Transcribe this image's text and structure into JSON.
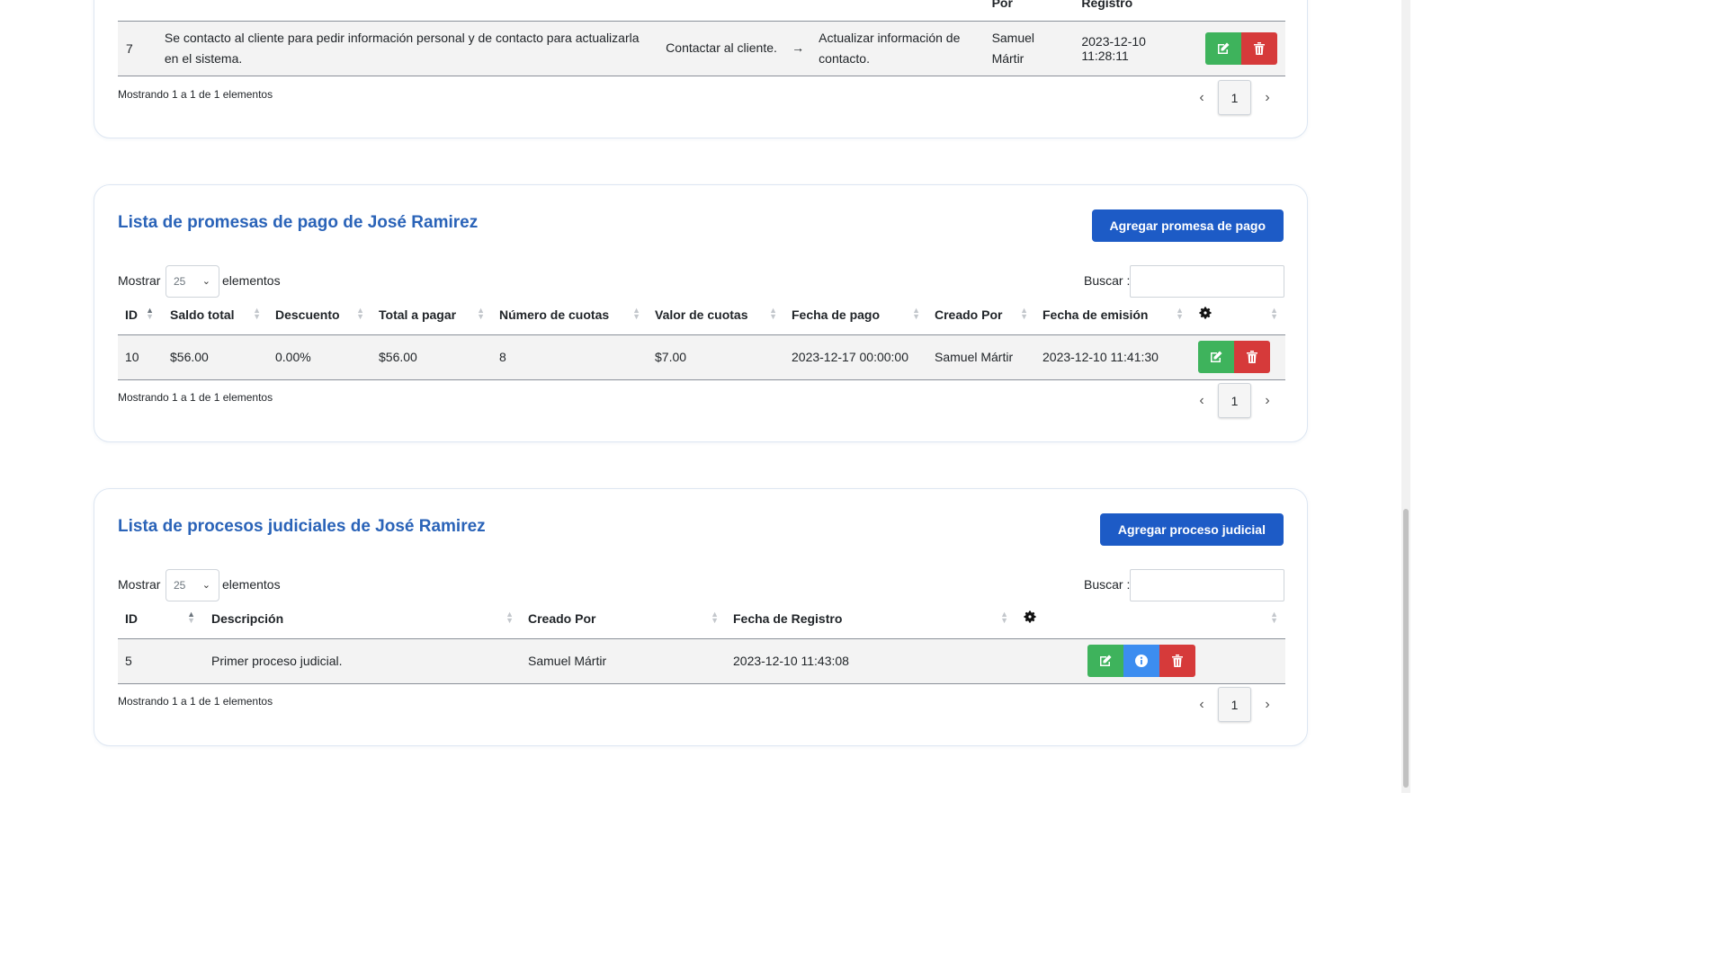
{
  "tracking_table": {
    "headers": {
      "por": "Por",
      "registro": "Registro"
    },
    "row": {
      "id": "7",
      "description": "Se contacto al cliente para pedir información personal y de contacto para actualizarla en el sistema.",
      "action": "Contactar al cliente.",
      "arrow": "→",
      "result": "Actualizar información de contacto.",
      "created_by": "Samuel Mártir",
      "date": "2023-12-10 11:28:11"
    },
    "info": "Mostrando 1 a 1 de 1 elementos",
    "page": "1"
  },
  "payment_promises": {
    "title": "Lista de promesas de pago de José Ramirez",
    "add_button": "Agregar promesa de pago",
    "show_label": "Mostrar",
    "page_size": "25",
    "elements_label": "elementos",
    "search_label": "Buscar :",
    "search_value": "",
    "columns": [
      "ID",
      "Saldo total",
      "Descuento",
      "Total a pagar",
      "Número de cuotas",
      "Valor de cuotas",
      "Fecha de pago",
      "Creado Por",
      "Fecha de emisión"
    ],
    "row": {
      "id": "10",
      "saldo_total": "$56.00",
      "descuento": "0.00%",
      "total_pagar": "$56.00",
      "num_cuotas": "8",
      "valor_cuotas": "$7.00",
      "fecha_pago": "2023-12-17 00:00:00",
      "creado_por": "Samuel Mártir",
      "fecha_emision": "2023-12-10 11:41:30"
    },
    "info": "Mostrando 1 a 1 de 1 elementos",
    "page": "1"
  },
  "judicial_processes": {
    "title": "Lista de procesos judiciales de José Ramirez",
    "add_button": "Agregar proceso judicial",
    "show_label": "Mostrar",
    "page_size": "25",
    "elements_label": "elementos",
    "search_label": "Buscar :",
    "search_value": "",
    "columns": [
      "ID",
      "Descripción",
      "Creado Por",
      "Fecha de Registro"
    ],
    "row": {
      "id": "5",
      "descripcion": "Primer proceso judicial.",
      "creado_por": "Samuel Mártir",
      "fecha_registro": "2023-12-10 11:43:08"
    },
    "info": "Mostrando 1 a 1 de 1 elementos",
    "page": "1"
  },
  "icons": {
    "edit": "edit-icon",
    "delete": "trash-icon",
    "info": "info-icon",
    "settings": "gear-icon",
    "prev": "chevron-left-icon",
    "next": "chevron-right-icon",
    "dropdown": "chevron-down-icon"
  },
  "colors": {
    "title": "#2a63b8",
    "primary": "#1d5bc6",
    "edit": "#3eb35c",
    "info": "#3c8df0",
    "delete": "#d63a3a"
  }
}
